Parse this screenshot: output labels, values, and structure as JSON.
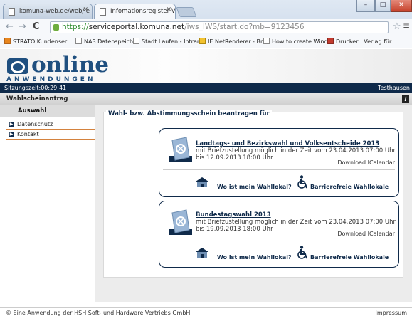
{
  "browser": {
    "tabs": [
      {
        "label": "komuna-web.de/web/le"
      },
      {
        "label": "Infomationsregister Versio"
      }
    ],
    "address": {
      "scheme": "https://",
      "host": "serviceportal.komuna.net",
      "path": "/iws_IWS/start.do?mb=9123456"
    },
    "bookmarks": [
      "STRATO Kundenser...",
      "NAS Datenspeicher",
      "Stadt Laufen - Intran...",
      "IE NetRenderer - Bro...",
      "How to create Wind...",
      "Drucker | Verlag für ..."
    ]
  },
  "header": {
    "logo_main": "online",
    "logo_sub": "ANWENDUNGEN"
  },
  "session": {
    "label": "Sitzungszeit:00:29:41",
    "user": "Testhausen"
  },
  "section": {
    "title": "Wahlscheinantrag"
  },
  "sidebar": {
    "active": "Auswahl",
    "items": [
      {
        "label": "Datenschutz"
      },
      {
        "label": "Kontakt"
      }
    ]
  },
  "main": {
    "panel_title": "Wahl- bzw. Abstimmungsschein beantragen für",
    "cards": [
      {
        "title": "Landtags- und Bezirkswahl und Volksentscheide 2013",
        "desc": "mit Briefzustellung möglich in der Zeit  vom 23.04.2013 07:00 Uhr bis 12.09.2013 18:00 Uhr",
        "download": "Download ICalendar",
        "link_wahllokal": "Wo ist mein Wahllokal?",
        "link_barriere": "Barrierefreie Wahllokale"
      },
      {
        "title": "Bundestagswahl 2013",
        "desc": "mit Briefzustellung möglich in der Zeit  vom 23.04.2013 07:00 Uhr bis 19.09.2013 18:00 Uhr",
        "download": "Download ICalendar",
        "link_wahllokal": "Wo ist mein Wahllokal?",
        "link_barriere": "Barrierefreie Wahllokale"
      }
    ]
  },
  "footer": {
    "text": "© Eine Anwendung der HSH Soft- und Hardware Vertriebs GmbH",
    "impressum": "Impressum"
  }
}
